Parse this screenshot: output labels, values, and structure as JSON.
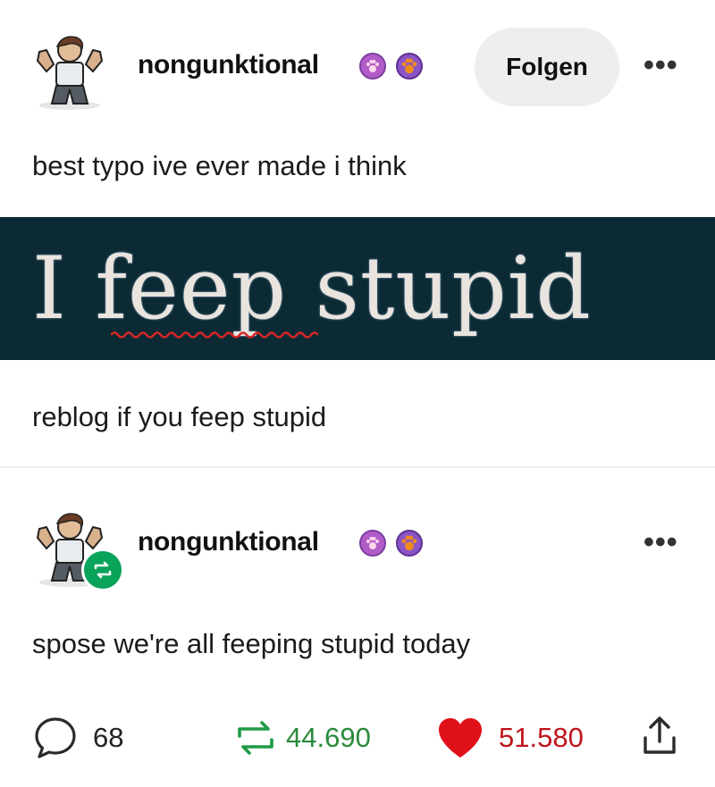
{
  "post": {
    "author": "nongunktional",
    "follow_label": "Folgen",
    "more_label": "•••",
    "caption": "best typo ive ever made i think",
    "meme_text": "I feep stupid",
    "below_text": "reblog if you feep stupid"
  },
  "reblog": {
    "author": "nongunktional",
    "more_label": "•••",
    "text": "spose we're all feeping stupid today"
  },
  "stats": {
    "comments": "68",
    "reblogs": "44.690",
    "likes": "51.580"
  },
  "colors": {
    "meme_bg": "#0c2a33",
    "reblog_green": "#0aa35a",
    "like_red": "#e0101a",
    "badge_purple": "#b15cc8"
  },
  "icons": [
    "avatar",
    "paw-badge-icon",
    "paw-badge-icon",
    "more-icon",
    "reblog-icon",
    "comment-icon",
    "heart-icon",
    "share-icon"
  ]
}
